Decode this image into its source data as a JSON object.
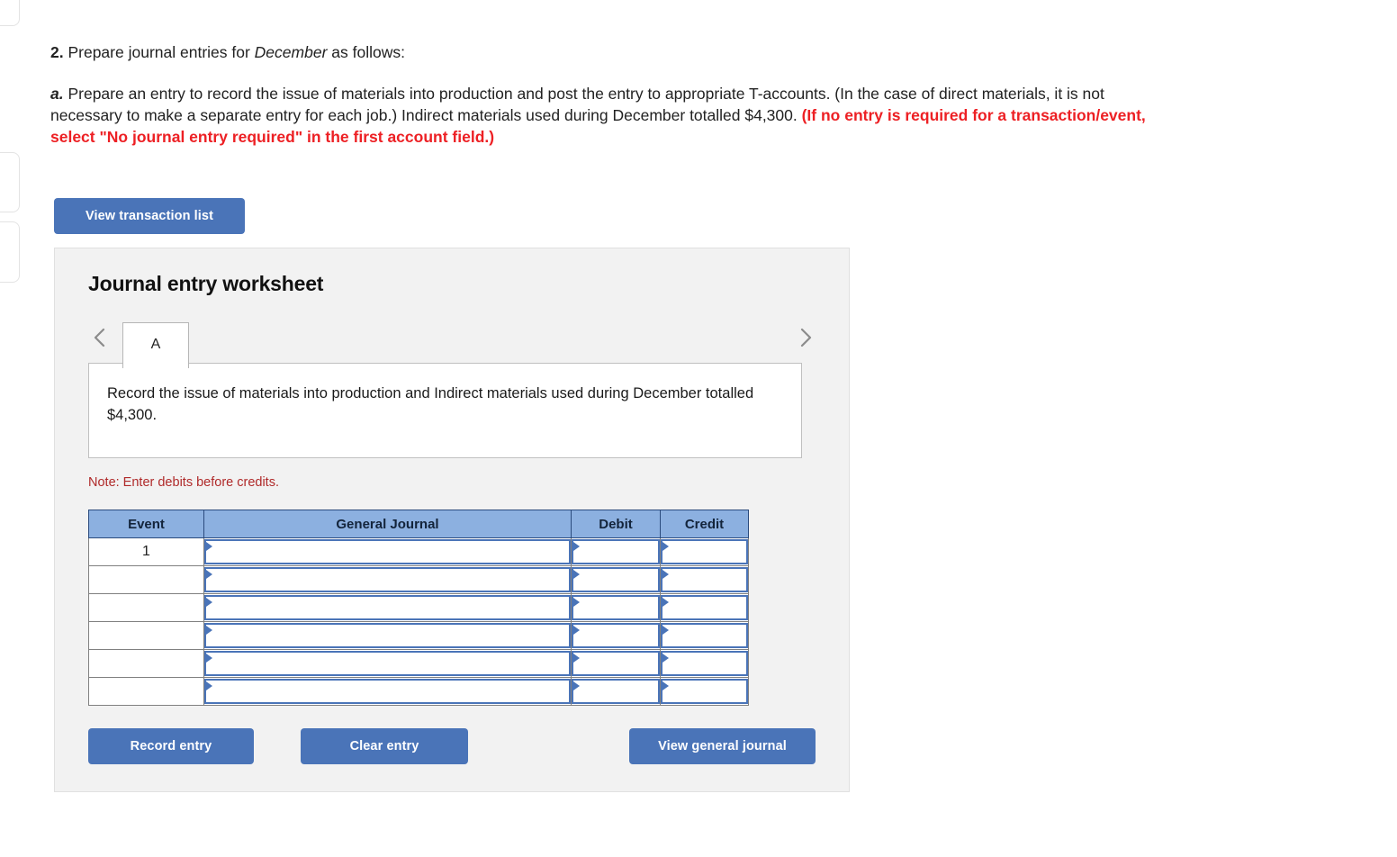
{
  "question": {
    "number": "2.",
    "number_rest": " Prepare journal entries for ",
    "emphasis": "December",
    "number_tail": " as follows:",
    "alpha": "a.",
    "body_part1": " Prepare an entry to record the issue of materials into production and post the entry to appropriate T-accounts. (In the case of direct materials, it is not necessary to make a separate entry for each job.) Indirect materials used during December totalled $4,300. ",
    "body_red": "(If no entry is required for a transaction/event, select \"No journal entry required\" in the first account field.)"
  },
  "toolbar": {
    "view_transaction_list_label": "View transaction list"
  },
  "worksheet": {
    "title": "Journal entry worksheet",
    "prev_icon": "chevron-left-icon",
    "next_icon": "chevron-right-icon",
    "tabs": [
      {
        "label": "A",
        "active": true
      }
    ],
    "description": "Record the issue of materials into production and Indirect materials used during December totalled $4,300.",
    "note": "Note: Enter debits before credits.",
    "table": {
      "headers": [
        "Event",
        "General Journal",
        "Debit",
        "Credit"
      ],
      "rows": [
        {
          "event": "1",
          "general_journal": "",
          "debit": "",
          "credit": ""
        },
        {
          "event": "",
          "general_journal": "",
          "debit": "",
          "credit": ""
        },
        {
          "event": "",
          "general_journal": "",
          "debit": "",
          "credit": ""
        },
        {
          "event": "",
          "general_journal": "",
          "debit": "",
          "credit": ""
        },
        {
          "event": "",
          "general_journal": "",
          "debit": "",
          "credit": ""
        },
        {
          "event": "",
          "general_journal": "",
          "debit": "",
          "credit": ""
        }
      ]
    },
    "actions": {
      "record_entry_label": "Record entry",
      "clear_entry_label": "Clear entry",
      "view_general_journal_label": "View general journal"
    }
  },
  "colors": {
    "button_blue": "#4a74b8",
    "header_blue": "#8cb0e0",
    "alert_red": "#ed2024",
    "note_red": "#b02a2a",
    "panel_gray": "#f2f2f2"
  }
}
